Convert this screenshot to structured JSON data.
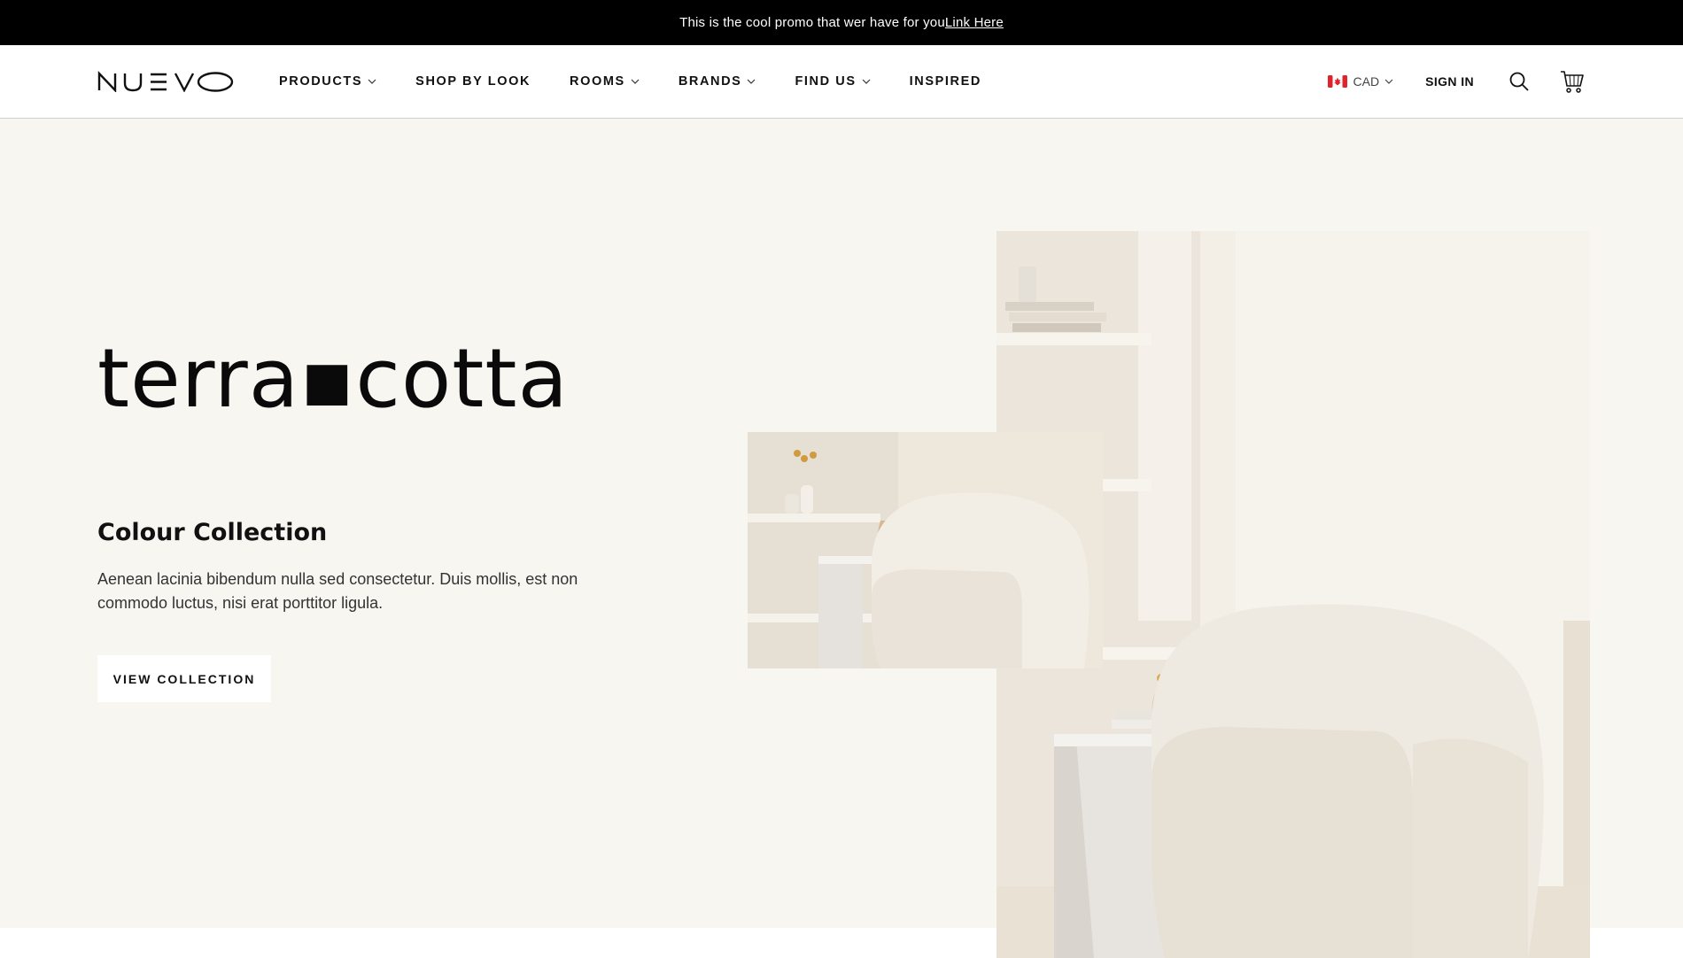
{
  "promo": {
    "text": "This is the cool promo that wer have for you",
    "link": "Link Here"
  },
  "nav": {
    "logo": "NUEVO",
    "items": [
      {
        "label": "PRODUCTS",
        "dropdown": true
      },
      {
        "label": "SHOP BY LOOK",
        "dropdown": false
      },
      {
        "label": "ROOMS",
        "dropdown": true
      },
      {
        "label": "BRANDS",
        "dropdown": true
      },
      {
        "label": "FIND US",
        "dropdown": true
      },
      {
        "label": "INSPIRED",
        "dropdown": false
      }
    ],
    "currency": "CAD",
    "signin": "SIGN IN"
  },
  "hero": {
    "title": "terra▪cotta",
    "subtitle": "Colour Collection",
    "description": "Aenean lacinia bibendum nulla sed consectetur. Duis mollis, est non commodo luctus, nisi erat porttitor ligula.",
    "cta": "VIEW COLLECTION"
  },
  "colors": {
    "promo_bg": "#000000",
    "hero_bg": "#f8f6f1",
    "text": "#111111",
    "flag_red": "#e0242b"
  },
  "icons": [
    "chevron-down-icon",
    "canada-flag-icon",
    "search-icon",
    "cart-icon"
  ]
}
